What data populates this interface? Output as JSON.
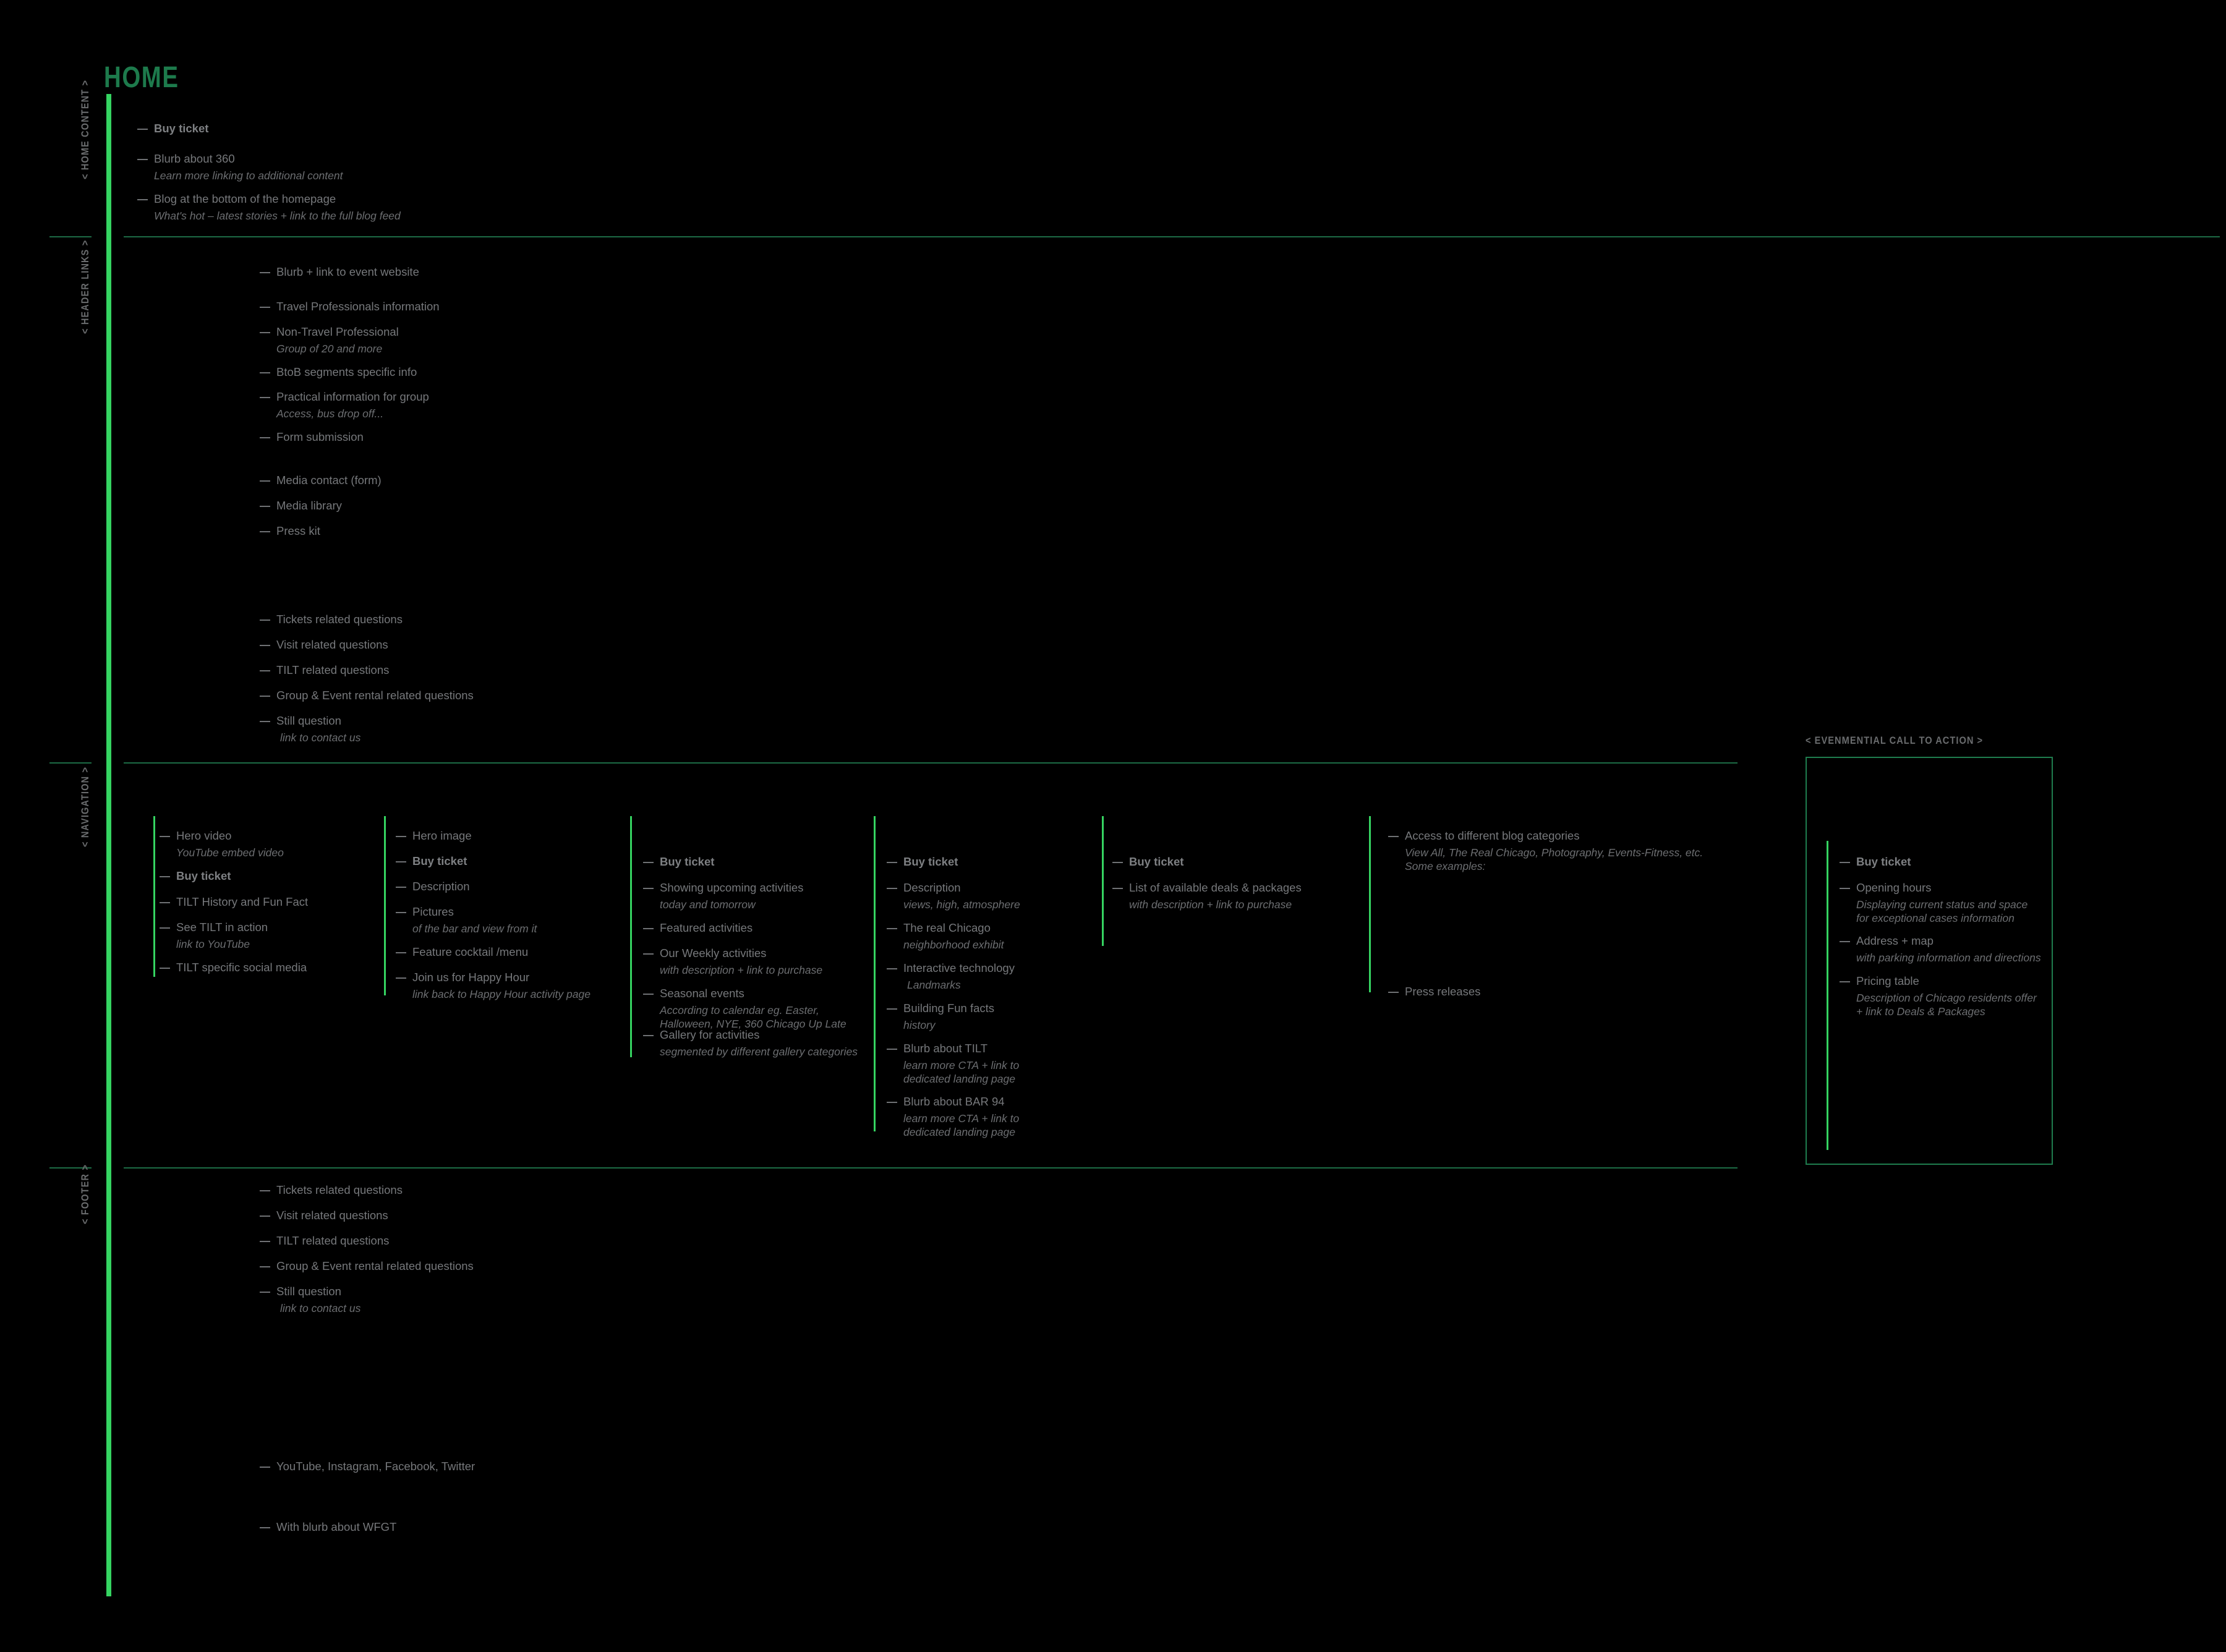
{
  "page": {
    "title": "HOME",
    "accent_green": "#35d461",
    "line_green": "#1d6b45",
    "title_green": "#1d7a4c",
    "text_gray": "#76787b",
    "background": "#000000"
  },
  "sections": {
    "home_content": "< HOME CONTENT >",
    "header_links": "< HEADER LINKS >",
    "navigation": "< NAVIGATION >",
    "footer": "< FOOTER >",
    "cta": "< EVENMENTIAL CALL TO ACTION >"
  },
  "home_content": {
    "items": [
      {
        "label": "Buy ticket",
        "sub": "",
        "bold": true
      },
      {
        "label": "Blurb about 360",
        "sub": "Learn more linking to additional content",
        "bold": false
      },
      {
        "label": "Blog at the bottom of the homepage",
        "sub": "What's hot – latest stories + link to the full blog feed",
        "bold": false
      }
    ]
  },
  "header_links": {
    "group_a": [
      {
        "label": "Blurb + link to event website",
        "sub": "",
        "bold": false
      },
      {
        "label": "Travel Professionals information",
        "sub": "",
        "bold": false
      },
      {
        "label": "Non-Travel Professional",
        "sub": "Group of 20 and more",
        "bold": false
      },
      {
        "label": "BtoB segments specific info",
        "sub": "",
        "bold": false
      },
      {
        "label": "Practical information for group",
        "sub": "Access, bus drop off...",
        "bold": false
      },
      {
        "label": "Form submission",
        "sub": "",
        "bold": false
      }
    ],
    "group_b": [
      {
        "label": "Media contact (form)",
        "sub": "",
        "bold": false
      },
      {
        "label": "Media library",
        "sub": "",
        "bold": false
      },
      {
        "label": "Press kit",
        "sub": "",
        "bold": false
      }
    ],
    "group_c": [
      {
        "label": "Tickets related questions",
        "sub": "",
        "bold": false
      },
      {
        "label": "Visit related questions",
        "sub": "",
        "bold": false
      },
      {
        "label": "TILT related questions",
        "sub": "",
        "bold": false
      },
      {
        "label": "Group & Event rental related questions",
        "sub": "",
        "bold": false
      },
      {
        "label": "Still question",
        "sub": "link to contact us",
        "bold": false
      }
    ]
  },
  "navigation": {
    "columns": [
      {
        "name": "column-1",
        "items": [
          {
            "label": "Hero video",
            "sub": "YouTube embed video",
            "bold": false
          },
          {
            "label": "Buy ticket",
            "sub": "",
            "bold": true
          },
          {
            "label": "TILT History and Fun Fact",
            "sub": "",
            "bold": false
          },
          {
            "label": "See TILT in action",
            "sub": "link to YouTube",
            "bold": false
          },
          {
            "label": "TILT specific social media",
            "sub": "",
            "bold": false
          }
        ]
      },
      {
        "name": "column-2",
        "items": [
          {
            "label": "Hero image",
            "sub": "",
            "bold": false
          },
          {
            "label": "Buy ticket",
            "sub": "",
            "bold": true
          },
          {
            "label": "Description",
            "sub": "",
            "bold": false
          },
          {
            "label": "Pictures",
            "sub": "of the bar and view from it",
            "bold": false
          },
          {
            "label": "Feature cocktail /menu",
            "sub": "",
            "bold": false
          },
          {
            "label": "Join us for Happy Hour",
            "sub": "link back to Happy Hour activity page",
            "bold": false
          }
        ]
      },
      {
        "name": "column-3",
        "items": [
          {
            "label": "Buy ticket",
            "sub": "",
            "bold": true
          },
          {
            "label": "Showing upcoming activities",
            "sub": "today and tomorrow",
            "bold": false
          },
          {
            "label": "Featured activities",
            "sub": "",
            "bold": false
          },
          {
            "label": "Our Weekly activities",
            "sub": "with description + link to purchase",
            "bold": false
          },
          {
            "label": "Seasonal events",
            "sub": "According to calendar eg. Easter,  Halloween, NYE, 360 Chicago Up Late",
            "bold": false
          },
          {
            "label": "Gallery for activities",
            "sub": "segmented by different gallery categories",
            "bold": false
          }
        ]
      },
      {
        "name": "column-4",
        "items": [
          {
            "label": "Buy ticket",
            "sub": "",
            "bold": true
          },
          {
            "label": "Description",
            "sub": "views, high, atmosphere",
            "bold": false
          },
          {
            "label": "The real Chicago",
            "sub": "neighborhood exhibit",
            "bold": false
          },
          {
            "label": "Interactive technology",
            "sub": "Landmarks",
            "bold": false
          },
          {
            "label": "Building Fun facts",
            "sub": "history",
            "bold": false
          },
          {
            "label": "Blurb about TILT",
            "sub": "learn more CTA + link to dedicated landing page",
            "bold": false
          },
          {
            "label": "Blurb about BAR 94",
            "sub": "learn more CTA + link to dedicated landing page",
            "bold": false
          }
        ]
      },
      {
        "name": "column-5",
        "items": [
          {
            "label": "Buy ticket",
            "sub": "",
            "bold": true
          },
          {
            "label": "List of available deals & packages",
            "sub": "with description + link to purchase",
            "bold": false
          }
        ]
      },
      {
        "name": "column-6",
        "items": [
          {
            "label": "Access to different blog categories",
            "sub": "View All, The Real Chicago, Photography, Events-Fitness, etc. Some examples:",
            "bold": false
          },
          {
            "label": "Press releases",
            "sub": "",
            "bold": false
          }
        ]
      }
    ]
  },
  "cta_panel": {
    "items": [
      {
        "label": "Buy ticket",
        "sub": "",
        "bold": true
      },
      {
        "label": "Opening hours",
        "sub": "Displaying current status and space for exceptional cases information",
        "bold": false
      },
      {
        "label": "Address + map",
        "sub": "with parking information and directions",
        "bold": false
      },
      {
        "label": "Pricing table",
        "sub": "Description of Chicago residents offer + link to Deals & Packages",
        "bold": false
      }
    ]
  },
  "footer": {
    "faq": [
      {
        "label": "Tickets related questions",
        "sub": "",
        "bold": false
      },
      {
        "label": "Visit related questions",
        "sub": "",
        "bold": false
      },
      {
        "label": "TILT related questions",
        "sub": "",
        "bold": false
      },
      {
        "label": "Group & Event rental related questions",
        "sub": "",
        "bold": false
      },
      {
        "label": "Still question",
        "sub": "link to contact us",
        "bold": false
      }
    ],
    "social": [
      {
        "label": "YouTube, Instagram, Facebook, Twitter",
        "sub": "",
        "bold": false
      }
    ],
    "legal": [
      {
        "label": "With blurb about WFGT",
        "sub": "",
        "bold": false
      }
    ]
  }
}
